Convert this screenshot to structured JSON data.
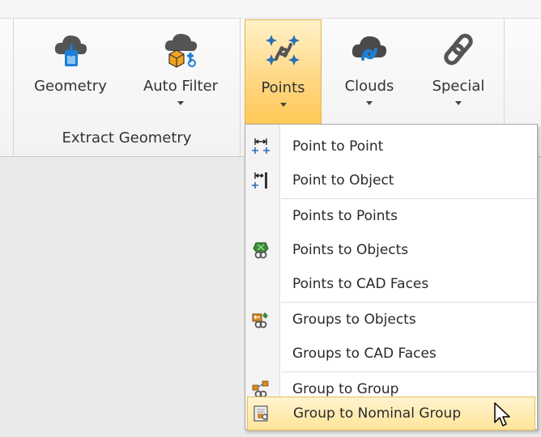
{
  "ribbon": {
    "buttons": [
      {
        "label": "Geometry",
        "icon": "cloud-download-icon",
        "dropdown": false
      },
      {
        "label": "Auto Filter",
        "icon": "cloud-cube-filter-icon",
        "dropdown": true
      },
      {
        "label": "Points",
        "icon": "points-link-icon",
        "dropdown": true,
        "active": true
      },
      {
        "label": "Clouds",
        "icon": "cloud-link-icon",
        "dropdown": true
      },
      {
        "label": "Special",
        "icon": "chain-link-icon",
        "dropdown": true
      }
    ],
    "group_label": "Extract Geometry"
  },
  "menu": {
    "items": [
      {
        "label": "Point to Point",
        "icon": "point-to-point-icon"
      },
      {
        "label": "Point to Object",
        "icon": "point-to-object-icon"
      },
      {
        "label": "Points to Points",
        "icon": ""
      },
      {
        "label": "Points to Objects",
        "icon": "points-to-objects-icon"
      },
      {
        "label": "Points to CAD Faces",
        "icon": ""
      },
      {
        "label": "Groups to Objects",
        "icon": "groups-to-objects-icon"
      },
      {
        "label": "Groups to CAD Faces",
        "icon": ""
      },
      {
        "label": "Group to Group",
        "icon": "group-to-group-icon"
      },
      {
        "label": "Group to Nominal Group",
        "icon": "group-to-nominal-group-icon",
        "highlighted": true
      }
    ]
  },
  "colors": {
    "active_fill": "#ffd680",
    "active_border": "#e4b14a",
    "icon_blue": "#1e7fd6",
    "icon_gray": "#555555"
  }
}
